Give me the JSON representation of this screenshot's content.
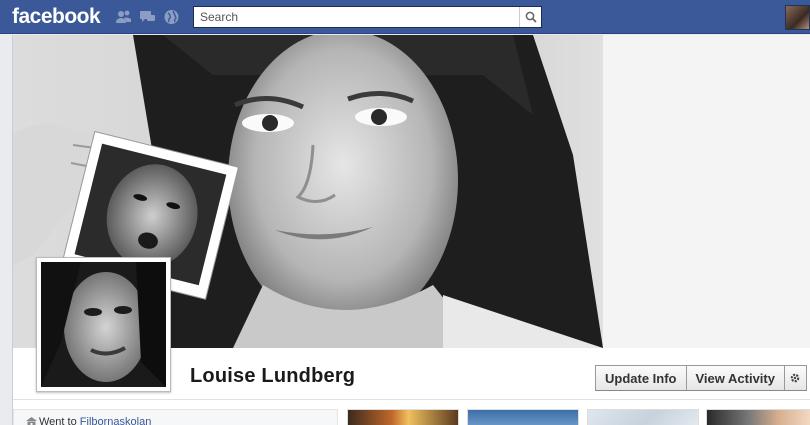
{
  "header": {
    "logo": "facebook",
    "search_placeholder": "Search"
  },
  "profile": {
    "name": "Louise Lundberg",
    "buttons": {
      "update_info": "Update Info",
      "view_activity": "View Activity"
    },
    "info": {
      "went_to_prefix": "Went to",
      "school": "Filbornaskolan"
    }
  },
  "icons": [
    "friends-icon",
    "messages-icon",
    "notifications-globe-icon",
    "search-icon",
    "gear-icon",
    "school-icon"
  ],
  "colors": {
    "brand_blue": "#3b5998",
    "link_blue": "#3b5998"
  }
}
